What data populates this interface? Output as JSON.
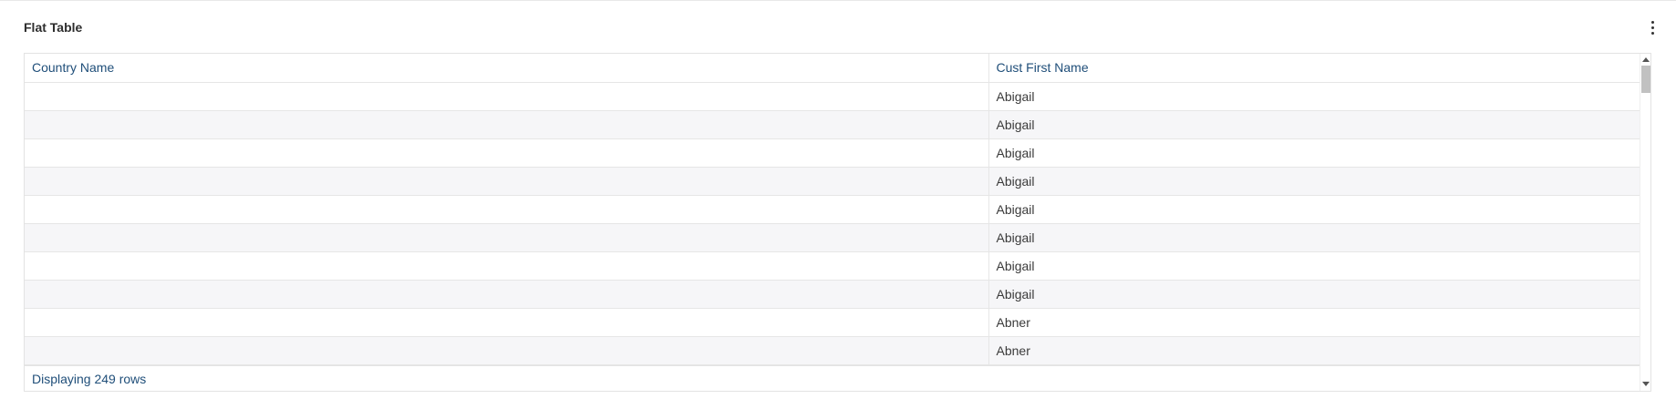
{
  "widget": {
    "title": "Flat Table"
  },
  "table": {
    "columns": [
      "Country Name",
      "Cust First Name"
    ],
    "rows": [
      [
        "",
        "Abigail"
      ],
      [
        "",
        "Abigail"
      ],
      [
        "",
        "Abigail"
      ],
      [
        "",
        "Abigail"
      ],
      [
        "",
        "Abigail"
      ],
      [
        "",
        "Abigail"
      ],
      [
        "",
        "Abigail"
      ],
      [
        "",
        "Abigail"
      ],
      [
        "",
        "Abner"
      ],
      [
        "",
        "Abner"
      ]
    ],
    "footer_text": "Displaying 249 rows"
  },
  "icons": {
    "menu": "kebab-menu-icon",
    "scroll_up": "scroll-up-arrow-icon",
    "scroll_down": "scroll-down-arrow-icon"
  }
}
